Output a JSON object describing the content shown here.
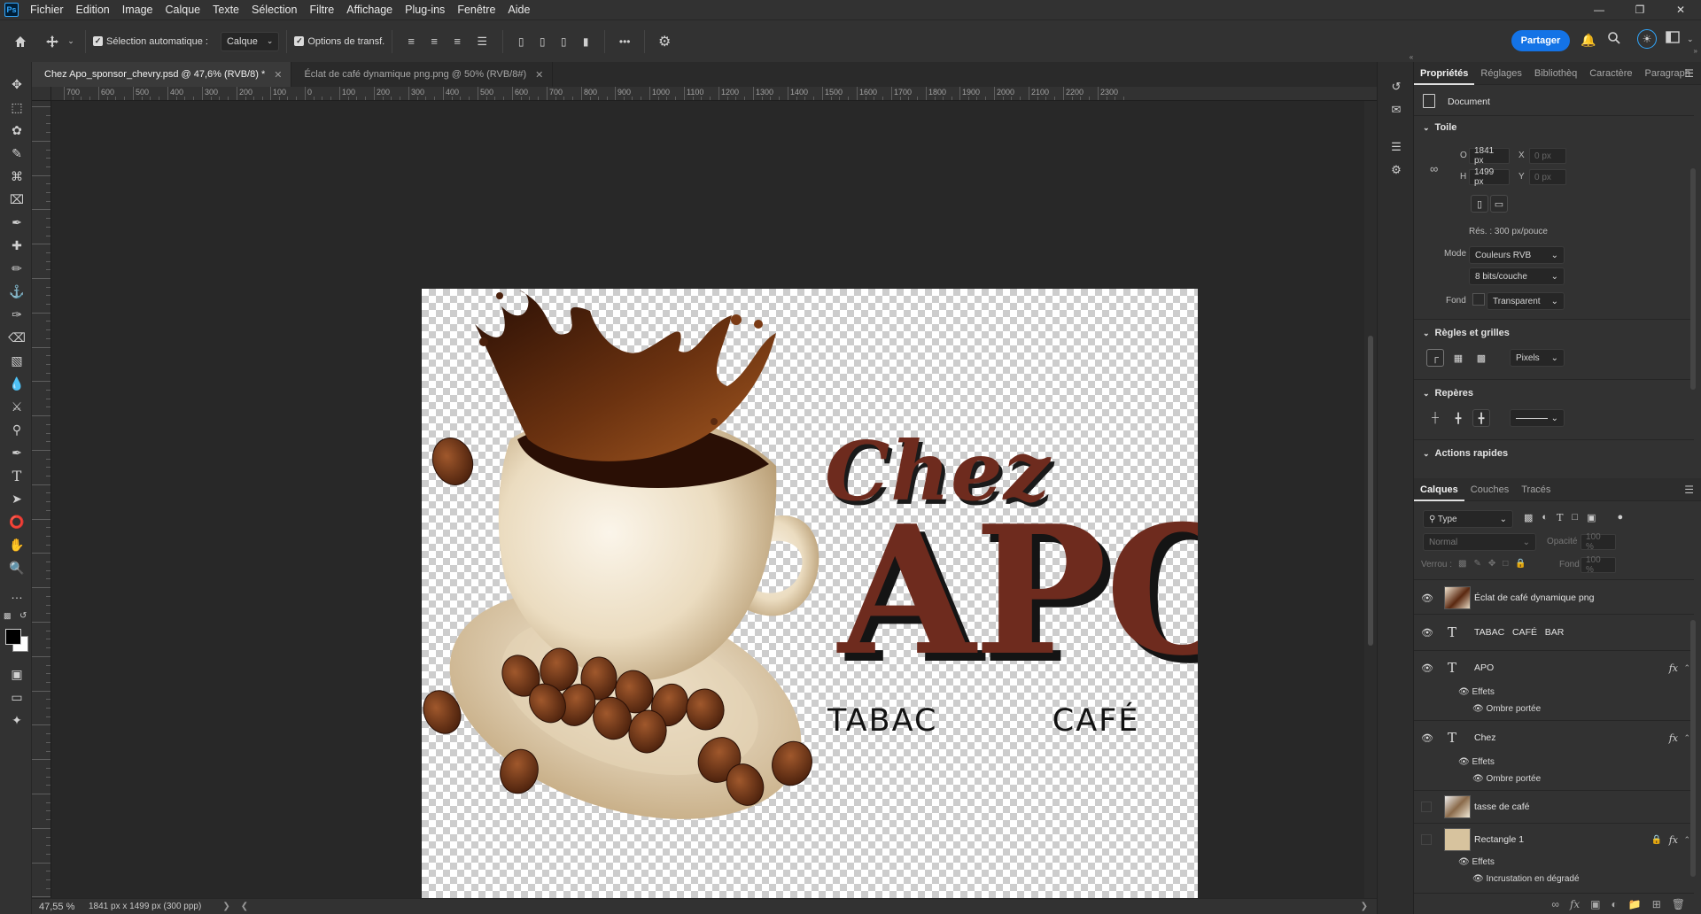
{
  "app": {
    "logo": "Ps",
    "menu": [
      "Fichier",
      "Edition",
      "Image",
      "Calque",
      "Texte",
      "Sélection",
      "Filtre",
      "Affichage",
      "Plug-ins",
      "Fenêtre",
      "Aide"
    ]
  },
  "options_bar": {
    "auto_select_label": "Sélection automatique :",
    "auto_select_checked": true,
    "auto_select_target": "Calque",
    "transform_options_label": "Options de transf.",
    "more": "•••",
    "share_label": "Partager"
  },
  "tabs": [
    {
      "label": "Chez Apo_sponsor_chevry.psd @ 47,6% (RVB/8) *",
      "active": true
    },
    {
      "label": "Éclat de café dynamique png.png @ 50% (RVB/8#)",
      "active": false
    }
  ],
  "ruler": {
    "labels": [
      "700",
      "600",
      "500",
      "400",
      "300",
      "200",
      "100",
      "0",
      "100",
      "200",
      "300",
      "400",
      "500",
      "600",
      "700",
      "800",
      "900",
      "1000",
      "1100",
      "1200",
      "1300",
      "1400",
      "1500",
      "1600",
      "1700",
      "1800",
      "1900",
      "2000",
      "2100",
      "2200",
      "2300"
    ]
  },
  "artwork": {
    "chez": "Chez",
    "apo": "APO",
    "subtitle": "TABAC   CAFÉ   BAR",
    "brand_color": "#6e2b1e"
  },
  "status": {
    "zoom": "47,55 %",
    "doc_size": "1841 px x 1499 px (300 ppp)"
  },
  "properties": {
    "tabs": [
      "Propriétés",
      "Réglages",
      "Bibliothèq",
      "Caractère",
      "Paragraph"
    ],
    "document_label": "Document",
    "canvas": {
      "title": "Toile",
      "width_label": "O",
      "width": "1841 px",
      "height_label": "H",
      "height": "1499 px",
      "x_label": "X",
      "x_placeholder": "0 px",
      "y_label": "Y",
      "y_placeholder": "0 px",
      "resolution": "Rés. : 300 px/pouce",
      "mode_label": "Mode",
      "mode": "Couleurs RVB",
      "bits": "8 bits/couche",
      "fond_label": "Fond",
      "fond": "Transparent"
    },
    "rulers_grids": {
      "title": "Règles et grilles",
      "unit": "Pixels"
    },
    "guides": {
      "title": "Repères"
    },
    "quick_actions": {
      "title": "Actions rapides"
    }
  },
  "layers": {
    "tabs": [
      "Calques",
      "Couches",
      "Tracés"
    ],
    "filter": "Type",
    "blend_mode": "Normal",
    "opacity_label": "Opacité :",
    "opacity": "100 %",
    "lock_label": "Verrou :",
    "fill_label": "Fond :",
    "fill": "100 %",
    "effects_label": "Effets",
    "items": [
      {
        "name": "Éclat de café dynamique png",
        "kind": "image",
        "visible": true
      },
      {
        "name": "TABAC   CAFÉ   BAR",
        "kind": "text",
        "visible": true
      },
      {
        "name": "APO",
        "kind": "text",
        "visible": true,
        "effect": "Ombre portée"
      },
      {
        "name": "Chez",
        "kind": "text",
        "visible": true,
        "effect": "Ombre portée"
      },
      {
        "name": "tasse de café",
        "kind": "image",
        "visible": false
      },
      {
        "name": "Rectangle 1",
        "kind": "shape",
        "visible": false,
        "effect": "Incrustation en dégradé"
      }
    ]
  }
}
